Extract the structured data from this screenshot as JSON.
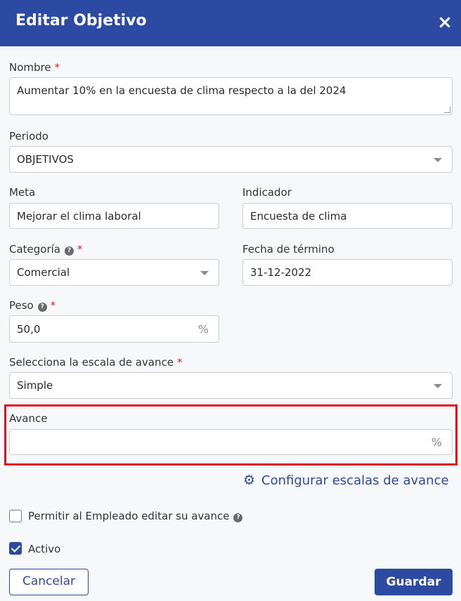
{
  "dialog": {
    "title": "Editar Objetivo",
    "close_symbol": "×"
  },
  "form": {
    "nombre": {
      "label": "Nombre",
      "required_mark": "*",
      "value": "Aumentar 10% en la encuesta de clima respecto a la del 2024"
    },
    "periodo": {
      "label": "Periodo",
      "value": "OBJETIVOS"
    },
    "meta": {
      "label": "Meta",
      "value": "Mejorar el clima laboral"
    },
    "indicador": {
      "label": "Indicador",
      "value": "Encuesta de clima"
    },
    "categoria": {
      "label": "Categoría",
      "help_symbol": "?",
      "required_mark": "*",
      "value": "Comercial"
    },
    "fecha_termino": {
      "label": "Fecha de término",
      "value": "31-12-2022"
    },
    "peso": {
      "label": "Peso",
      "help_symbol": "?",
      "required_mark": "*",
      "value": "50,0",
      "suffix": "%"
    },
    "escala": {
      "label": "Selecciona la escala de avance",
      "required_mark": "*",
      "value": "Simple"
    },
    "avance": {
      "label": "Avance",
      "value": "",
      "suffix": "%"
    },
    "config_link": {
      "label": "Configurar escalas de avance"
    },
    "permitir": {
      "label": "Permitir al Empleado editar su avance",
      "help_symbol": "?",
      "checked": false
    },
    "activo": {
      "label": "Activo",
      "checked": true
    }
  },
  "actions": {
    "cancel_label": "Cancelar",
    "save_label": "Guardar"
  },
  "colors": {
    "primary": "#2d4aa3",
    "required": "#d92b2b",
    "highlight": "#e0141d"
  }
}
